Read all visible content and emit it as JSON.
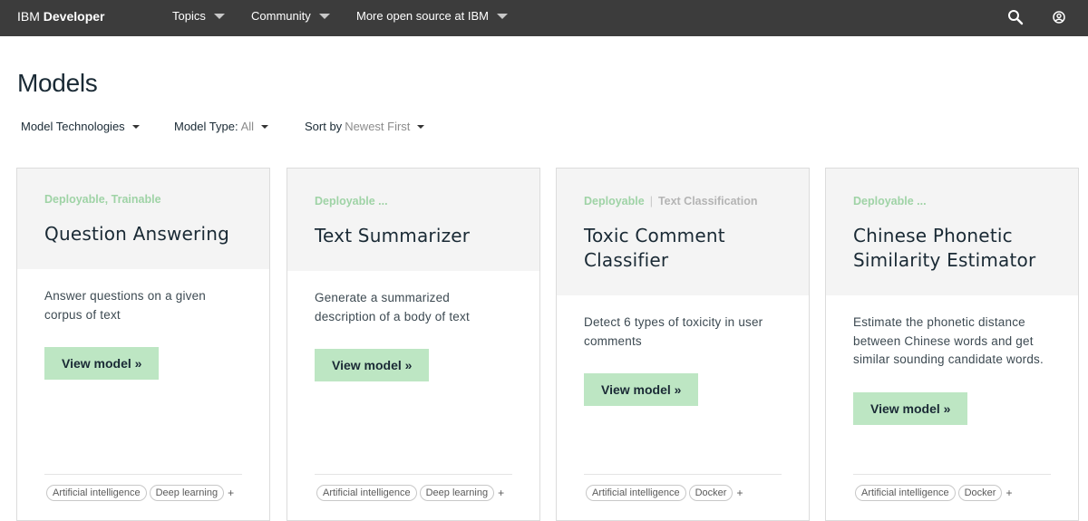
{
  "header": {
    "brand_light": "IBM ",
    "brand_bold": "Developer",
    "nav": [
      "Topics",
      "Community",
      "More open source at IBM"
    ]
  },
  "icons": {
    "search": "search-icon",
    "user": "user-icon",
    "caret": "caret-down-icon"
  },
  "page": {
    "title": "Models"
  },
  "filters": {
    "technologies": "Model Technologies",
    "type_label": "Model Type:",
    "type_value": "All",
    "sort_label": "Sort by",
    "sort_value": "Newest First"
  },
  "cards": [
    {
      "tags": "Deployable, Trainable",
      "title": "Question Answering",
      "desc": "Answer questions on a given corpus of text",
      "button": "View model »",
      "pills": [
        "Artificial intelligence",
        "Deep learning"
      ],
      "more": "+"
    },
    {
      "tags": "Deployable ...",
      "title": "Text Summarizer",
      "desc": "Generate a summarized description of a body of text",
      "button": "View model »",
      "pills": [
        "Artificial intelligence",
        "Deep learning"
      ],
      "more": "+"
    },
    {
      "tags": "Deployable",
      "tags_extra": "Text Classification",
      "tags_sep": "|",
      "title": "Toxic Comment Classifier",
      "desc": "Detect 6 types of toxicity in user comments",
      "button": "View model »",
      "pills": [
        "Artificial intelligence",
        "Docker"
      ],
      "more": "+"
    },
    {
      "tags": "Deployable ...",
      "title": "Chinese Phonetic Similarity Estimator",
      "desc": "Estimate the phonetic distance between Chinese words and get similar sounding candidate words.",
      "button": "View model »",
      "pills": [
        "Artificial intelligence",
        "Docker"
      ],
      "more": "+"
    }
  ],
  "colors": {
    "topbar": "#3c3c3c",
    "tag_green": "#9fd3a6",
    "button_green": "#bde6c3",
    "card_head": "#f4f4f4"
  }
}
